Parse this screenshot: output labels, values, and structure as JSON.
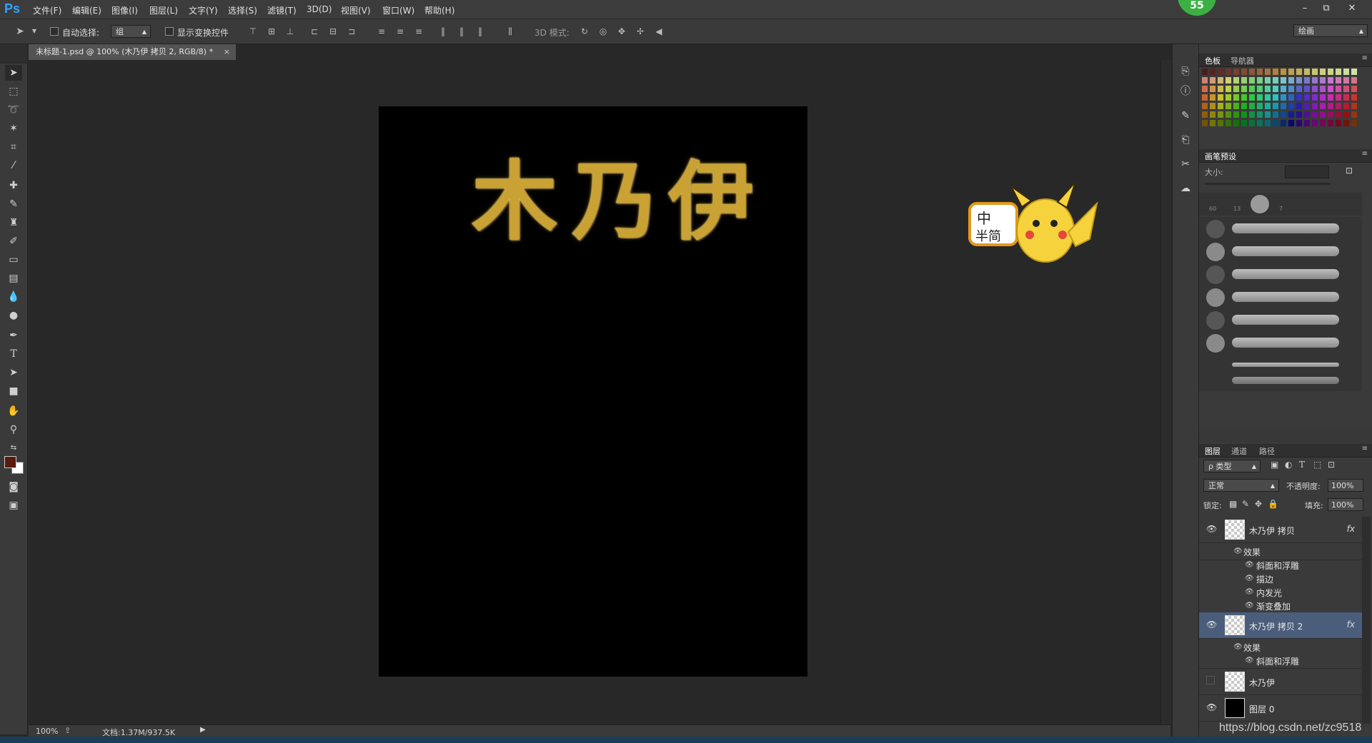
{
  "app": {
    "logo": "Ps",
    "menus": [
      "文件(F)",
      "编辑(E)",
      "图像(I)",
      "图层(L)",
      "文字(Y)",
      "选择(S)",
      "滤镜(T)",
      "3D(D)",
      "视图(V)",
      "窗口(W)",
      "帮助(H)"
    ],
    "badge": "55",
    "window_buttons": [
      "–",
      "⧉",
      "✕"
    ]
  },
  "options": {
    "auto_select_label": "自动选择:",
    "auto_select_value": "组",
    "show_transform_label": "显示变换控件",
    "mode3d_label": "3D 模式:",
    "workspace_value": "绘画"
  },
  "document": {
    "tab_title": "未标题-1.psd @ 100% (木乃伊 拷贝 2, RGB/8) *",
    "close": "×",
    "text_chars": [
      "木",
      "乃",
      "伊"
    ],
    "zoom": "100%",
    "doc_info": "文档:1.37M/937.5K"
  },
  "ime": {
    "top": "中",
    "bottom": "半简"
  },
  "panels": {
    "swatches": {
      "tabs": [
        "色板",
        "导航器"
      ]
    },
    "brush": {
      "tab": "画笔预设",
      "size_label": "大小:",
      "preset_numbers": [
        "60",
        "13",
        "7"
      ]
    },
    "layers": {
      "tabs": [
        "图层",
        "通道",
        "路径"
      ],
      "filter": "ρ 类型",
      "blend_mode": "正常",
      "opacity_label": "不透明度:",
      "opacity_value": "100%",
      "lock_label": "锁定:",
      "fill_label": "填充:",
      "fill_value": "100%",
      "fx": "fx",
      "effects_label": "效果",
      "items": [
        {
          "name": "木乃伊 拷贝",
          "effects": [
            "斜面和浮雕",
            "描边",
            "内发光",
            "渐变叠加"
          ]
        },
        {
          "name": "木乃伊 拷贝 2",
          "effects": [
            "斜面和浮雕"
          ]
        },
        {
          "name": "木乃伊"
        },
        {
          "name": "图层 0"
        }
      ]
    }
  },
  "watermark": "https://blog.csdn.net/zc9518",
  "colors": {
    "foreground": "#5a1a0c",
    "background": "#ffffff",
    "selected_layer": "#4a5e7c",
    "canvas": "#000000",
    "gold": "#c9a233"
  }
}
